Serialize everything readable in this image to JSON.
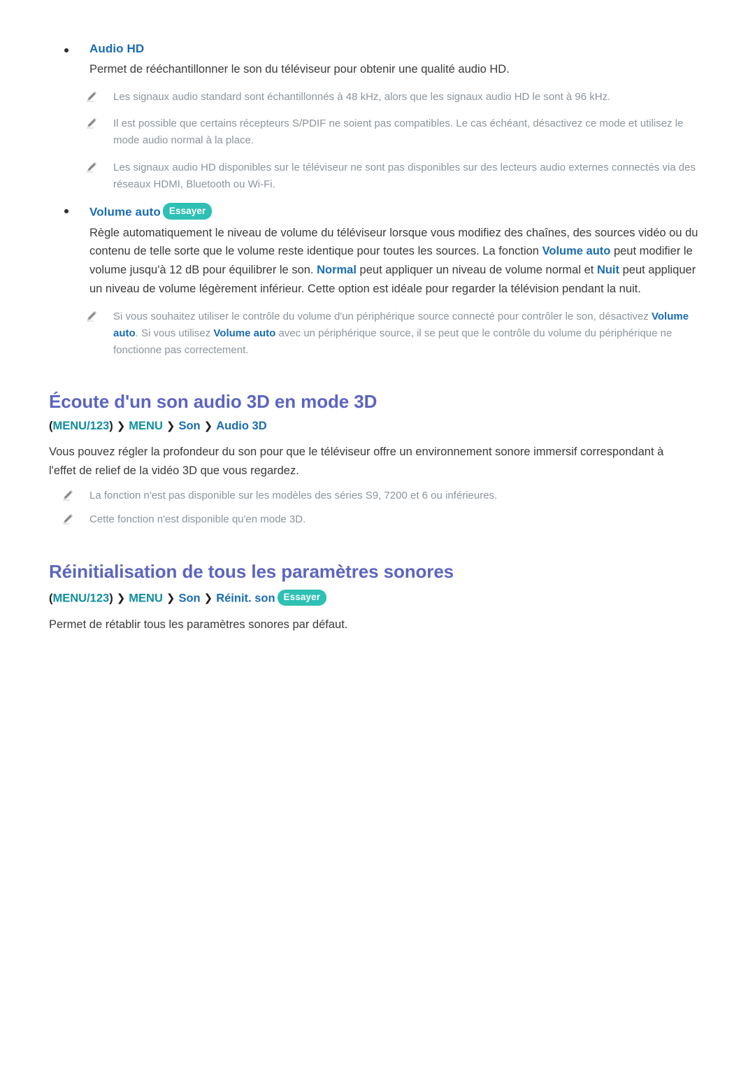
{
  "page": {
    "sections": [
      {
        "type": "bullet",
        "id": "audio-hd",
        "title": "Audio HD",
        "badge": null,
        "body": [
          {
            "id": "audio-hd-desc",
            "runs": [
              {
                "t": "Permet de rééchantillonner le son du téléviseur pour obtenir une qualité audio HD.",
                "b": false
              }
            ]
          }
        ],
        "notes": [
          {
            "id": "note-sampling",
            "runs": [
              {
                "t": "Les signaux audio standard sont échantillonnés à 48 kHz, alors que les signaux audio HD le sont à 96 kHz.",
                "b": false
              }
            ]
          },
          {
            "id": "note-spdif",
            "runs": [
              {
                "t": "Il est possible que certains récepteurs S/PDIF ne soient pas compatibles. Le cas échéant, désactivez ce mode et utilisez le mode audio normal à la place.",
                "b": false
              }
            ]
          },
          {
            "id": "note-external-players",
            "runs": [
              {
                "t": "Les signaux audio HD disponibles sur le téléviseur ne sont pas disponibles sur des lecteurs audio externes connectés via des réseaux HDMI, Bluetooth ou Wi-Fi.",
                "b": false
              }
            ]
          }
        ]
      },
      {
        "type": "bullet",
        "id": "volume-auto",
        "title": "Volume auto",
        "badge": "Essayer",
        "body": [
          {
            "id": "volume-auto-desc",
            "runs": [
              {
                "t": "Règle automatiquement le niveau de volume du téléviseur lorsque vous modifiez des chaînes, des sources vidéo ou du contenu de telle sorte que le volume reste identique pour toutes les sources. La fonction ",
                "b": false
              },
              {
                "t": "Volume auto",
                "b": true
              },
              {
                "t": " peut modifier le volume jusqu'à 12 dB pour équilibrer le son. ",
                "b": false
              },
              {
                "t": "Normal",
                "b": true
              },
              {
                "t": " peut appliquer un niveau de volume normal et ",
                "b": false
              },
              {
                "t": "Nuit",
                "b": true
              },
              {
                "t": " peut appliquer un niveau de volume légèrement inférieur. Cette option est idéale pour regarder la télévision pendant la nuit.",
                "b": false
              }
            ]
          }
        ],
        "notes": [
          {
            "id": "note-source-device-volume",
            "runs": [
              {
                "t": "Si vous souhaitez utiliser le contrôle du volume d'un périphérique source connecté pour contrôler le son, désactivez ",
                "b": false
              },
              {
                "t": "Volume auto",
                "b": true
              },
              {
                "t": ". Si vous utilisez ",
                "b": false
              },
              {
                "t": "Volume auto",
                "b": true
              },
              {
                "t": " avec un périphérique source, il se peut que le contrôle du volume du périphérique ne fonctionne pas correctement.",
                "b": false
              }
            ]
          }
        ]
      },
      {
        "type": "heading",
        "id": "audio-3d",
        "title": "Écoute d'un son audio 3D en mode 3D",
        "breadcrumb": {
          "open_paren": "(",
          "menu123": "MENU/123",
          "close_paren": ")",
          "chevron": "❯",
          "crumbs": [
            {
              "label": "MENU",
              "color": "teal"
            },
            {
              "label": "Son",
              "color": "blue"
            },
            {
              "label": "Audio 3D",
              "color": "blue"
            }
          ],
          "badge": null
        },
        "body": [
          {
            "id": "audio-3d-desc",
            "runs": [
              {
                "t": "Vous pouvez régler la profondeur du son pour que le téléviseur offre un environnement sonore immersif correspondant à l'effet de relief de la vidéo 3D que vous regardez.",
                "b": false
              }
            ]
          }
        ],
        "notes": [
          {
            "id": "note-model-series",
            "runs": [
              {
                "t": "La fonction n'est pas disponible sur les modèles des séries S9, 7200 et 6 ou inférieures.",
                "b": false
              }
            ]
          },
          {
            "id": "note-3d-mode-only",
            "runs": [
              {
                "t": "Cette fonction n'est disponible qu'en mode 3D.",
                "b": false
              }
            ]
          }
        ]
      },
      {
        "type": "heading",
        "id": "reset-sound",
        "title": "Réinitialisation de tous les paramètres sonores",
        "breadcrumb": {
          "open_paren": "(",
          "menu123": "MENU/123",
          "close_paren": ")",
          "chevron": "❯",
          "crumbs": [
            {
              "label": "MENU",
              "color": "teal"
            },
            {
              "label": "Son",
              "color": "blue"
            },
            {
              "label": "Réinit. son",
              "color": "blue"
            }
          ],
          "badge": "Essayer"
        },
        "body": [
          {
            "id": "reset-sound-desc",
            "runs": [
              {
                "t": "Permet de rétablir tous les paramètres sonores par défaut.",
                "b": false
              }
            ]
          }
        ],
        "notes": []
      }
    ]
  },
  "colors": {
    "heading": "#5b65c0",
    "link_blue": "#1a6cb4",
    "teal": "#0f8fa0",
    "badge_bg": "#2ec0b4",
    "note_gray": "#8b949b",
    "body": "#3a3a3a"
  },
  "icons": {
    "note": "pencil-icon",
    "bullet": "bullet-dot",
    "chevron": "chevron-right-icon"
  }
}
